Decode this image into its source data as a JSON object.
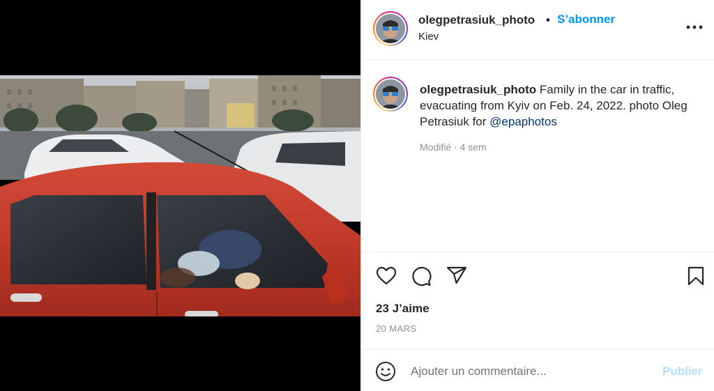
{
  "post": {
    "username": "olegpetrasiuk_photo",
    "separator": "•",
    "follow_label": "S’abonner",
    "location": "Kiev",
    "more_icon": "more-horizontal-icon",
    "caption": {
      "username": "olegpetrasiuk_photo",
      "text": " Family in the car in traffic, evacuating from Kyiv on Feb. 24, 2022. photo Oleg Petrasiuk for ",
      "mention": "@epaphotos"
    },
    "edited_label": "Modifié · 4 sem",
    "actions": {
      "like_icon": "heart-icon",
      "comment_icon": "comment-icon",
      "share_icon": "paper-plane-icon",
      "save_icon": "bookmark-icon"
    },
    "likes": "23 J’aime",
    "date": "20 MARS",
    "comment": {
      "emoji_icon": "smiley-icon",
      "placeholder": "Ajouter un commentaire...",
      "value": "",
      "publish_label": "Publier"
    }
  },
  "colors": {
    "accent": "#0095f6",
    "mention": "#00376b",
    "muted": "#8e8e8e",
    "publish_disabled": "#b2dffc",
    "media_background": "#000000"
  }
}
